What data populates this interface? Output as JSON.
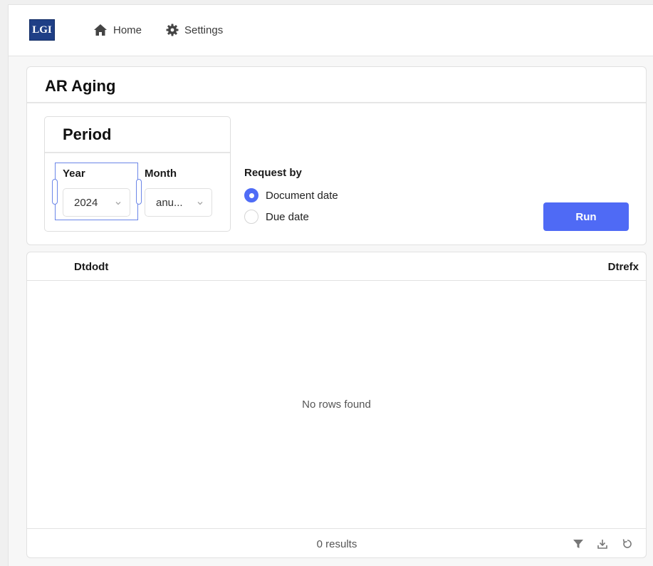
{
  "app": {
    "logo_text": "LGI"
  },
  "nav": {
    "home_label": "Home",
    "settings_label": "Settings"
  },
  "report": {
    "title": "AR Aging"
  },
  "period": {
    "title": "Period",
    "year_label": "Year",
    "year_value": "2024",
    "month_label": "Month",
    "month_value": "anu..."
  },
  "request": {
    "label": "Request by",
    "options": [
      {
        "label": "Document date",
        "checked": true
      },
      {
        "label": "Due date",
        "checked": false
      }
    ]
  },
  "actions": {
    "run_label": "Run"
  },
  "table": {
    "columns": [
      "Dtdodt",
      "Dtrefx"
    ],
    "empty_message": "No rows found",
    "results_text": "0 results"
  },
  "colors": {
    "accent": "#4f6af5",
    "selection": "#6b86e8"
  },
  "icons": [
    "home-icon",
    "gear-icon",
    "chevron-down-icon",
    "filter-icon",
    "download-icon",
    "reset-icon"
  ]
}
